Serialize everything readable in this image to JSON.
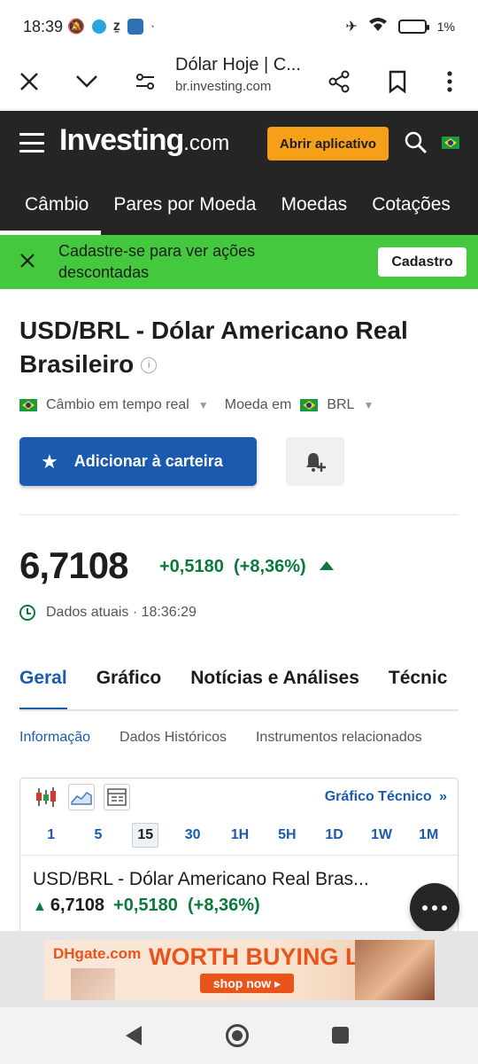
{
  "status": {
    "time": "18:39",
    "battery": "1%"
  },
  "browser": {
    "page_title": "Dólar Hoje | C...",
    "url": "br.investing.com"
  },
  "header": {
    "logo_main": "Investing",
    "logo_suffix": ".com",
    "open_app": "Abrir aplicativo",
    "nav": [
      "Câmbio",
      "Pares por Moeda",
      "Moedas",
      "Cotações"
    ]
  },
  "promo": {
    "text": "Cadastre-se para ver ações descontadas",
    "button": "Cadastro",
    "color": "#43c83e"
  },
  "instrument": {
    "title": "USD/BRL - Dólar Americano Real Brasileiro",
    "exchange_label": "Câmbio em tempo real",
    "currency_label": "Moeda em",
    "currency": "BRL",
    "add_portfolio": "Adicionar à carteira",
    "price": "6,7108",
    "change": "+0,5180",
    "change_pct": "(+8,36%)",
    "time_label": "Dados atuais · 18:36:29",
    "positive_color": "#0a7a3b"
  },
  "tabs": [
    "Geral",
    "Gráfico",
    "Notícias e Análises",
    "Técnic"
  ],
  "subtabs": [
    "Informação",
    "Dados Históricos",
    "Instrumentos relacionados"
  ],
  "chart_widget": {
    "technical_link": "Gráfico Técnico",
    "periods": [
      "1",
      "5",
      "15",
      "30",
      "1H",
      "5H",
      "1D",
      "1W",
      "1M"
    ],
    "active_period": "15",
    "name": "USD/BRL - Dólar Americano Real Bras...",
    "price": "6,7108",
    "change": "+0,5180",
    "change_pct": "(+8,36%)"
  },
  "ad": {
    "logo": "DHgate.com",
    "headline": "WORTH BUYING LIST",
    "button": "shop now ▸"
  },
  "colors": {
    "accent": "#1a5bb0",
    "header_bg": "#252525",
    "cta": "#f6a01a"
  }
}
